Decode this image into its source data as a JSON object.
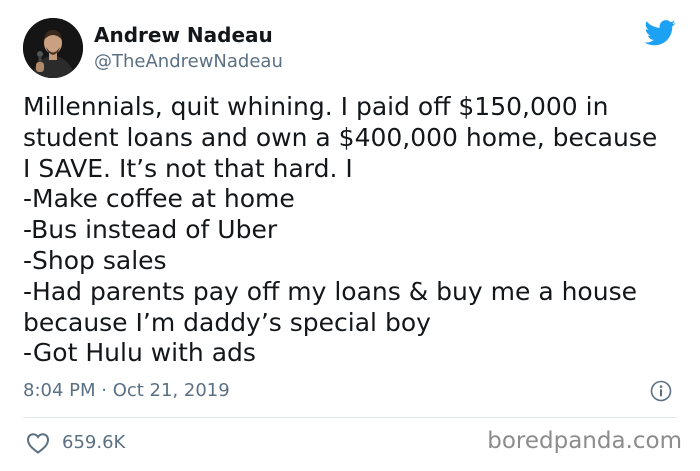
{
  "author": {
    "name": "Andrew Nadeau",
    "handle": "@TheAndrewNadeau",
    "avatar_icon": "person-with-microphone-avatar"
  },
  "tweet": {
    "lines": [
      "Millennials, quit whining. I paid off $150,000 in",
      "student loans and own a $400,000 home, because",
      "I SAVE. It’s not that hard. I",
      "-Make coffee at home",
      "-Bus instead of Uber",
      "-Shop sales",
      "-Had parents pay off my loans & buy me a house",
      "because I’m daddy’s special boy",
      "-Got Hulu with ads"
    ],
    "timestamp": "8:04 PM · Oct 21, 2019",
    "likes": "659.6K"
  },
  "icons": {
    "brand": "twitter-bird-icon",
    "info": "info-icon",
    "like": "heart-icon"
  },
  "colors": {
    "twitter_blue": "#1da1f2",
    "text": "#14171a",
    "secondary_text": "#5b7083",
    "divider": "#e1e8ed",
    "watermark": "#8c8c8c"
  },
  "watermark": "boredpanda.com"
}
